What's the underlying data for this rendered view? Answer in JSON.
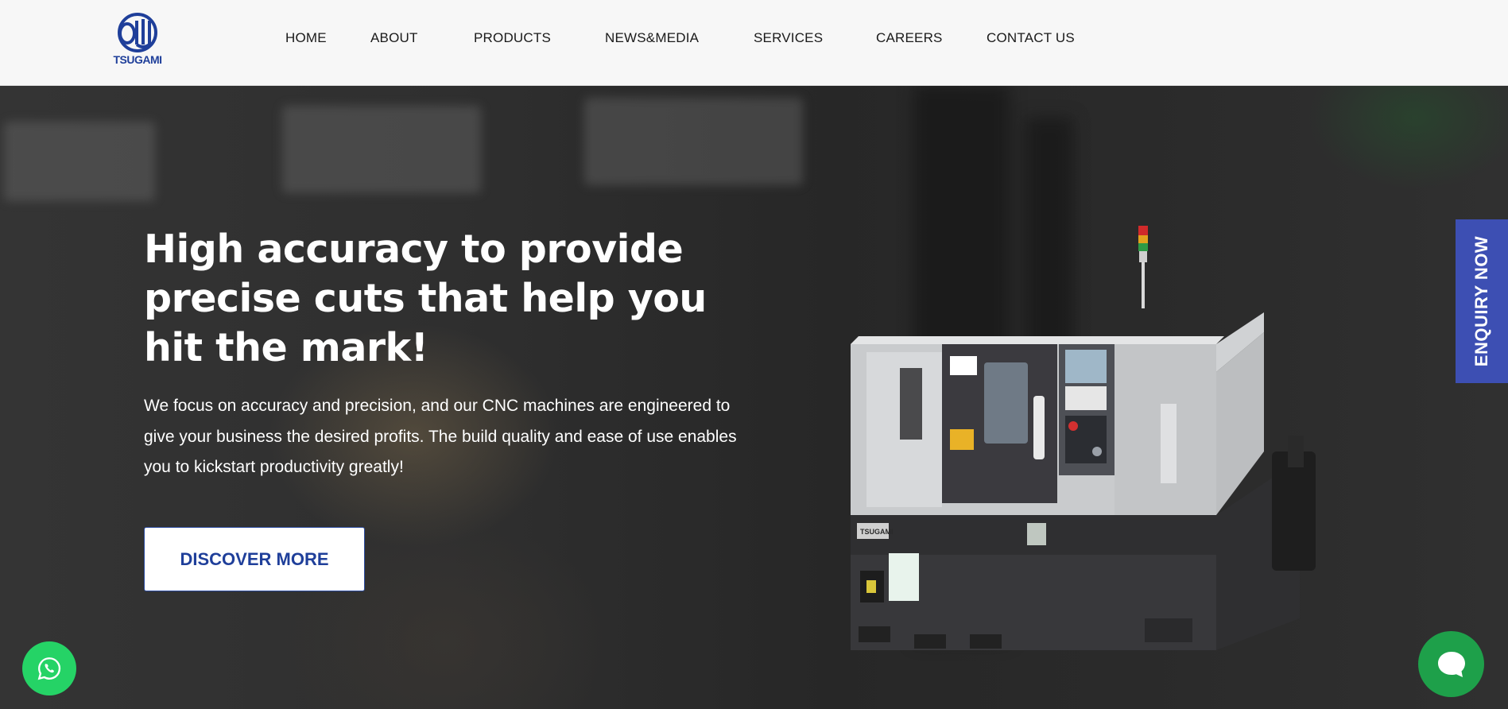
{
  "brand": {
    "name": "TSUGAMI",
    "color": "#1f3f9a"
  },
  "nav": {
    "items": [
      {
        "label": "HOME"
      },
      {
        "label": "ABOUT"
      },
      {
        "label": "PRODUCTS"
      },
      {
        "label": "NEWS&MEDIA"
      },
      {
        "label": "SERVICES"
      },
      {
        "label": "CAREERS"
      },
      {
        "label": "CONTACT US"
      }
    ]
  },
  "hero": {
    "headline": "High accuracy to provide precise cuts that help you hit the mark!",
    "description": "We focus on accuracy and precision, and our CNC machines are engineered to give your business the desired profits. The build quality and ease of use enables you to kickstart productivity greatly!",
    "cta_label": "DISCOVER MORE",
    "machine_label": "TSUGAMI"
  },
  "side_tab": {
    "label": "ENQUIRY NOW",
    "color": "#3d4fb3"
  },
  "floating": {
    "whatsapp_icon": "whatsapp-icon",
    "whatsapp_color": "#25d366",
    "chat_icon": "chat-bubble-icon",
    "chat_color": "#1ea04a"
  }
}
